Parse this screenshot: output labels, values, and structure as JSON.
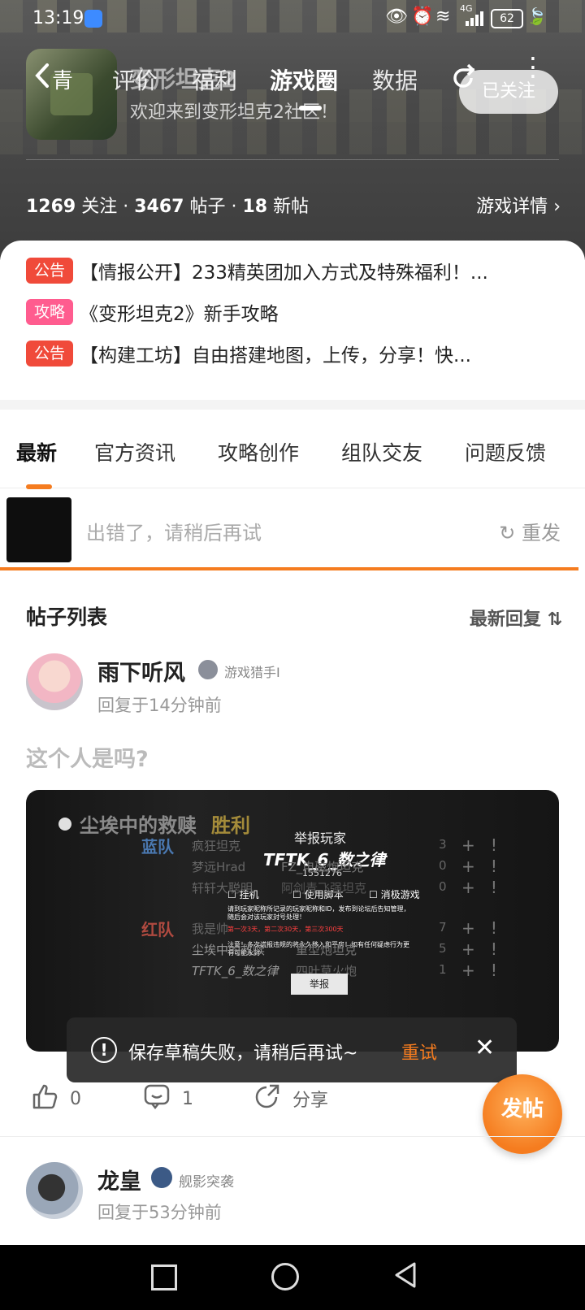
{
  "status_bar": {
    "time": "13:19",
    "network": "4G",
    "battery": "62"
  },
  "nav": {
    "back_label": "青",
    "tabs": [
      {
        "label": "评价",
        "active": false
      },
      {
        "label": "福利",
        "active": false
      },
      {
        "label": "游戏圈",
        "active": true
      },
      {
        "label": "数据",
        "active": false
      }
    ],
    "game_title_partial": "变形坦克2",
    "welcome": "欢迎来到变形坦克2社区！",
    "follow_label": "已关注"
  },
  "stats": {
    "followers": "1269",
    "followers_label": "关注",
    "posts": "3467",
    "posts_label": "帖子",
    "new_posts": "18",
    "new_posts_label": "新帖",
    "separator": "·",
    "detail_link": "游戏详情"
  },
  "announcements": [
    {
      "tag": "公告",
      "color": "#f04a3a",
      "text": "【情报公开】233精英团加入方式及特殊福利！..."
    },
    {
      "tag": "攻略",
      "color": "#ff5c8f",
      "text": "《变形坦克2》新手攻略"
    },
    {
      "tag": "公告",
      "color": "#f04a3a",
      "text": "【构建工坊】自由搭建地图，上传，分享！快..."
    }
  ],
  "category_tabs": [
    {
      "label": "最新",
      "active": true
    },
    {
      "label": "官方资讯",
      "active": false
    },
    {
      "label": "攻略创作",
      "active": false
    },
    {
      "label": "组队交友",
      "active": false
    },
    {
      "label": "问题反馈",
      "active": false
    }
  ],
  "upload_error": {
    "message": "出错了，请稍后再试",
    "retry_label": "重发"
  },
  "post_list": {
    "title": "帖子列表",
    "sort_label": "最新回复",
    "sort_icon": "sort-icon"
  },
  "post1": {
    "username": "雨下听风",
    "level": "游戏猎手I",
    "time": "回复于14分钟前",
    "text": "这个人是吗?",
    "likes": "0",
    "comments": "1",
    "share_label": "分享",
    "image": {
      "match_title": "尘埃中的救赎",
      "result": "胜利",
      "report_header": "举报玩家",
      "reported_player": "TFTK_6_数之律",
      "player_id": "1551276",
      "options": [
        "挂机",
        "使用脚本",
        "消极游戏"
      ],
      "notice1": "请到玩家昵称所记录的玩家昵称和ID，发布到论坛后告知管理，随后会对该玩家封号处理！",
      "notice2": "第一次3天，第二次30天，第三次300天",
      "notice3": "注意！多次谎报违规的将永久移入和平房！如有任何疑虑行为更有可能永封",
      "blue_team_label": "蓝队",
      "blue_players": [
        "疯狂坦克",
        "梦远Hrad",
        "轩轩大聪明"
      ],
      "red_team_label": "红队",
      "red_players": [
        "我是帅",
        "尘埃中的救赎",
        "TFTK_6_数之律"
      ],
      "right_column": [
        "FZ_电磁炮坦克",
        "阿剑青飞强坦克",
        "重型炮坦克",
        "四叶草火炮"
      ],
      "scores": [
        "3",
        "0",
        "0",
        "7",
        "5",
        "1"
      ],
      "report_button": "举报"
    }
  },
  "toast": {
    "message": "保存草稿失败，请稍后再试~",
    "retry_label": "重试"
  },
  "fab": {
    "label": "发帖"
  },
  "post2": {
    "username": "龙皇",
    "level": "舰影突袭",
    "time": "回复于53分钟前"
  }
}
